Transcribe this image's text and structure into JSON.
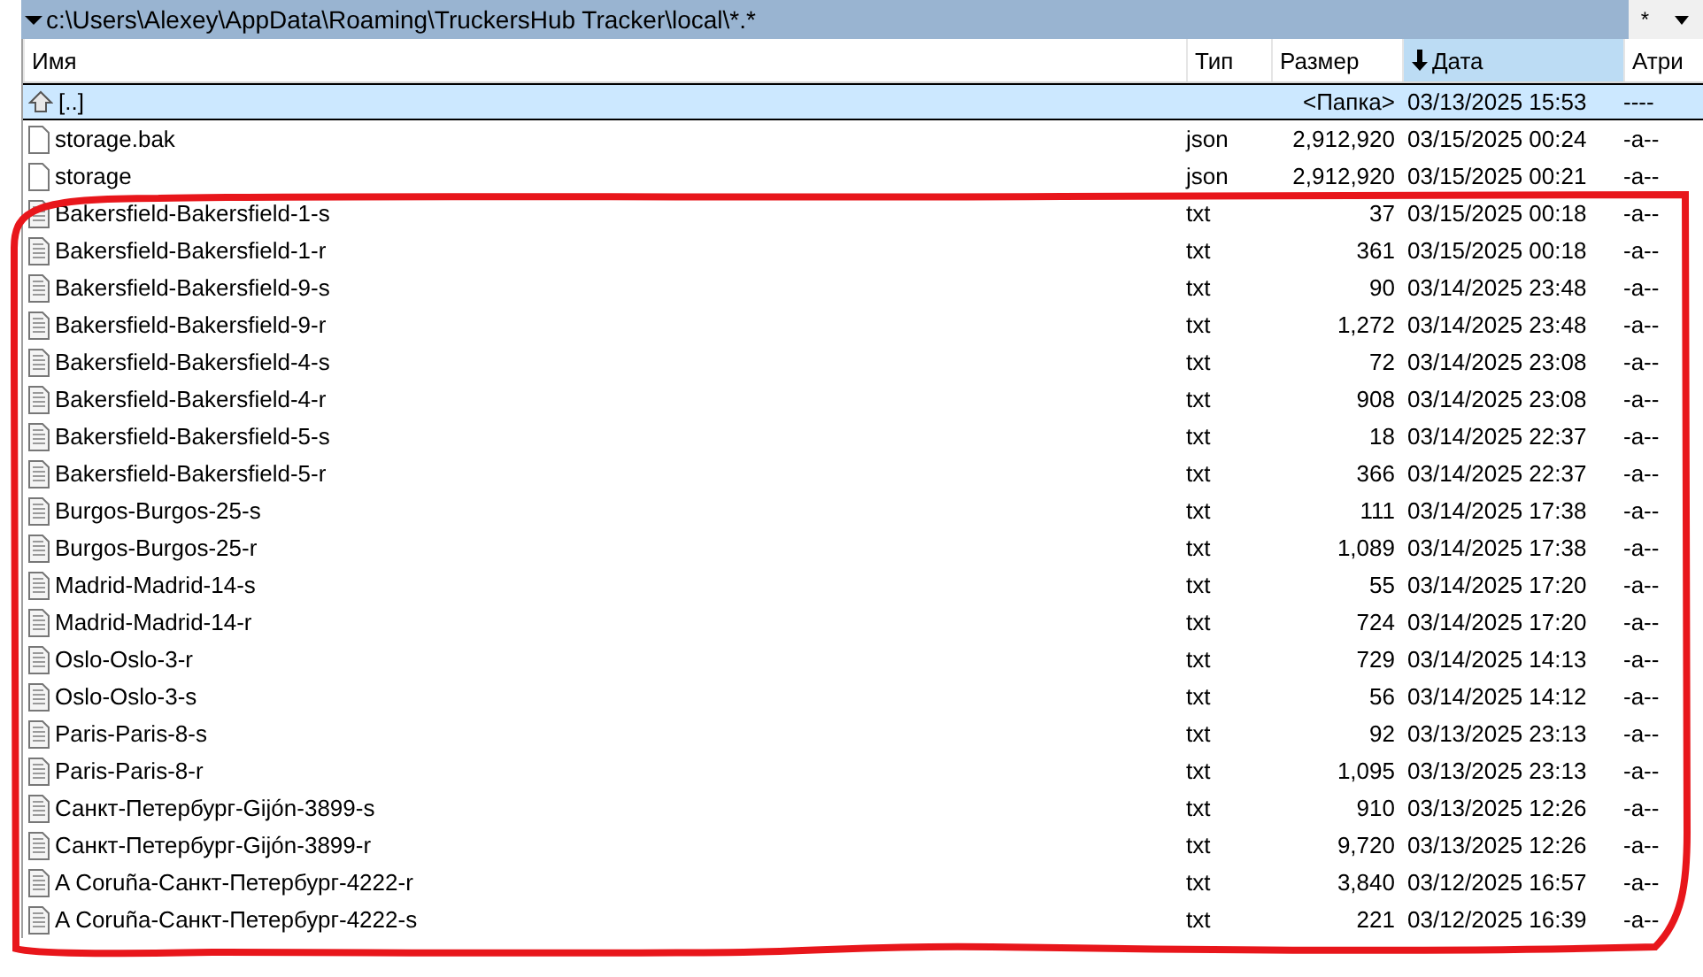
{
  "path_bar": {
    "path": "c:\\Users\\Alexey\\AppData\\Roaming\\TruckersHub Tracker\\local\\*.*",
    "filter": "*"
  },
  "columns": [
    {
      "label": "Имя",
      "sorted": false
    },
    {
      "label": "Тип",
      "sorted": false
    },
    {
      "label": "Размер",
      "sorted": false
    },
    {
      "label": "Дата",
      "sorted": true
    },
    {
      "label": "Атри",
      "sorted": false
    }
  ],
  "rows": [
    {
      "kind": "parent",
      "name": "[..]",
      "type": "",
      "size": "<Папка>",
      "date": "03/13/2025 15:53",
      "attr": "----",
      "selected": true
    },
    {
      "kind": "file",
      "name": "storage.bak",
      "type": "json",
      "size": "2,912,920",
      "date": "03/15/2025 00:24",
      "attr": "-a--",
      "selected": false
    },
    {
      "kind": "file",
      "name": "storage",
      "type": "json",
      "size": "2,912,920",
      "date": "03/15/2025 00:21",
      "attr": "-a--",
      "selected": false
    },
    {
      "kind": "text",
      "name": "Bakersfield-Bakersfield-1-s",
      "type": "txt",
      "size": "37",
      "date": "03/15/2025 00:18",
      "attr": "-a--",
      "selected": false
    },
    {
      "kind": "text",
      "name": "Bakersfield-Bakersfield-1-r",
      "type": "txt",
      "size": "361",
      "date": "03/15/2025 00:18",
      "attr": "-a--",
      "selected": false
    },
    {
      "kind": "text",
      "name": "Bakersfield-Bakersfield-9-s",
      "type": "txt",
      "size": "90",
      "date": "03/14/2025 23:48",
      "attr": "-a--",
      "selected": false
    },
    {
      "kind": "text",
      "name": "Bakersfield-Bakersfield-9-r",
      "type": "txt",
      "size": "1,272",
      "date": "03/14/2025 23:48",
      "attr": "-a--",
      "selected": false
    },
    {
      "kind": "text",
      "name": "Bakersfield-Bakersfield-4-s",
      "type": "txt",
      "size": "72",
      "date": "03/14/2025 23:08",
      "attr": "-a--",
      "selected": false
    },
    {
      "kind": "text",
      "name": "Bakersfield-Bakersfield-4-r",
      "type": "txt",
      "size": "908",
      "date": "03/14/2025 23:08",
      "attr": "-a--",
      "selected": false
    },
    {
      "kind": "text",
      "name": "Bakersfield-Bakersfield-5-s",
      "type": "txt",
      "size": "18",
      "date": "03/14/2025 22:37",
      "attr": "-a--",
      "selected": false
    },
    {
      "kind": "text",
      "name": "Bakersfield-Bakersfield-5-r",
      "type": "txt",
      "size": "366",
      "date": "03/14/2025 22:37",
      "attr": "-a--",
      "selected": false
    },
    {
      "kind": "text",
      "name": "Burgos-Burgos-25-s",
      "type": "txt",
      "size": "111",
      "date": "03/14/2025 17:38",
      "attr": "-a--",
      "selected": false
    },
    {
      "kind": "text",
      "name": "Burgos-Burgos-25-r",
      "type": "txt",
      "size": "1,089",
      "date": "03/14/2025 17:38",
      "attr": "-a--",
      "selected": false
    },
    {
      "kind": "text",
      "name": "Madrid-Madrid-14-s",
      "type": "txt",
      "size": "55",
      "date": "03/14/2025 17:20",
      "attr": "-a--",
      "selected": false
    },
    {
      "kind": "text",
      "name": "Madrid-Madrid-14-r",
      "type": "txt",
      "size": "724",
      "date": "03/14/2025 17:20",
      "attr": "-a--",
      "selected": false
    },
    {
      "kind": "text",
      "name": "Oslo-Oslo-3-r",
      "type": "txt",
      "size": "729",
      "date": "03/14/2025 14:13",
      "attr": "-a--",
      "selected": false
    },
    {
      "kind": "text",
      "name": "Oslo-Oslo-3-s",
      "type": "txt",
      "size": "56",
      "date": "03/14/2025 14:12",
      "attr": "-a--",
      "selected": false
    },
    {
      "kind": "text",
      "name": "Paris-Paris-8-s",
      "type": "txt",
      "size": "92",
      "date": "03/13/2025 23:13",
      "attr": "-a--",
      "selected": false
    },
    {
      "kind": "text",
      "name": "Paris-Paris-8-r",
      "type": "txt",
      "size": "1,095",
      "date": "03/13/2025 23:13",
      "attr": "-a--",
      "selected": false
    },
    {
      "kind": "text",
      "name": "Санкт-Петербург-Gijón-3899-s",
      "type": "txt",
      "size": "910",
      "date": "03/13/2025 12:26",
      "attr": "-a--",
      "selected": false
    },
    {
      "kind": "text",
      "name": "Санкт-Петербург-Gijón-3899-r",
      "type": "txt",
      "size": "9,720",
      "date": "03/13/2025 12:26",
      "attr": "-a--",
      "selected": false
    },
    {
      "kind": "text",
      "name": "A Coruña-Санкт-Петербург-4222-r",
      "type": "txt",
      "size": "3,840",
      "date": "03/12/2025 16:57",
      "attr": "-a--",
      "selected": false
    },
    {
      "kind": "text",
      "name": "A Coruña-Санкт-Петербург-4222-s",
      "type": "txt",
      "size": "221",
      "date": "03/12/2025 16:39",
      "attr": "-a--",
      "selected": false
    }
  ]
}
